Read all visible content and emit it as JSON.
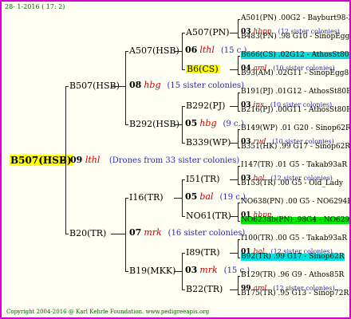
{
  "header": {
    "date": "28-  1-2016  ( 17:  2)"
  },
  "footer": {
    "text": "Copyright 2004-2016 @ Karl Kehrle Foundation.   www.pedigreeapis.org"
  },
  "root": {
    "name": "B507(HSB)",
    "year": "09",
    "code": "lthl",
    "info": "(Drones from 33 sister colonies)"
  },
  "gen1": [
    {
      "name": "B507(HSB)",
      "year": "08",
      "code": "hbg",
      "info": "(15 sister colonies)"
    },
    {
      "name": "B20(TR)",
      "year": "07",
      "code": "mrk",
      "info": "(16 sister colonies)"
    }
  ],
  "gen2": [
    {
      "name": "A507(HSB)",
      "year": "06",
      "code": "lthl",
      "info": "(15 c.)"
    },
    {
      "name": "B292(HSB)",
      "year": "05",
      "code": "hbg",
      "info": "(9 c.)"
    },
    {
      "name": "I16(TR)",
      "year": "05",
      "code": "bal",
      "info": "(19 c.)"
    },
    {
      "name": "B19(MKK)",
      "year": "03",
      "code": "mrk",
      "info": "(15 c.)"
    }
  ],
  "gen3": [
    {
      "name": "A507(PN)"
    },
    {
      "name": "B6(CS)"
    },
    {
      "name": "B292(PJ)"
    },
    {
      "name": "B339(WP)"
    },
    {
      "name": "I51(TR)"
    },
    {
      "name": "NO61(TR)"
    },
    {
      "name": "I89(TR)"
    },
    {
      "name": "B22(TR)"
    }
  ],
  "gen3_links": [
    {
      "year": "03",
      "code": "hbpn",
      "info": "(12 sister colonies)"
    },
    {
      "year": "04",
      "code": "aml",
      "info": "(10 sister colonies)"
    },
    {
      "year": "03",
      "code": "ins",
      "info": "(10 sister colonies)"
    },
    {
      "year": "03",
      "code": "rud",
      "info": "(10 sister colonies)"
    },
    {
      "year": "03",
      "code": "bal",
      "info": "(12 sister colonies)"
    },
    {
      "year": "01",
      "code": "hbpn",
      "info": ""
    },
    {
      "year": "01",
      "code": "bal",
      "info": "(12 sister colonies)"
    },
    {
      "year": "99",
      "code": "aml",
      "info": "(12 sister colonies)"
    }
  ],
  "gen4": [
    "A501(PN) .00G2 - Bayburt98-3",
    "B483(PN) .98  G10 - SinopEgg86R",
    "B666(CS) .02G12 - AthosSt80R",
    "B93(AM) .02G11 - SinopEgg86R",
    "B191(PJ) .01G12 - AthosSt80R",
    "B216(PJ) .00G11 - AthosSt80R",
    "B149(WP) .01 G20 - Sinop62R",
    "B351(HK) .99  G17 - Sinop62R",
    "I147(TR) .01   G5 - Takab93aR",
    "B153(TR) .00   G5 - Old_Lady",
    "NO638(PN) .00  G5 - NO6294R",
    "NO6238b(PN) .98G4 - NO6294R",
    "I100(TR) .00   G5 - Takab93aR",
    "B92(TR) .99    G17 - Sinop62R",
    "B129(TR) .96    G9 - Athos85R",
    "B175(TR) .95  G13 - Sinop72R"
  ],
  "gen4_highlight": {
    "2": "cyan",
    "11": "green",
    "13": "cyan"
  }
}
